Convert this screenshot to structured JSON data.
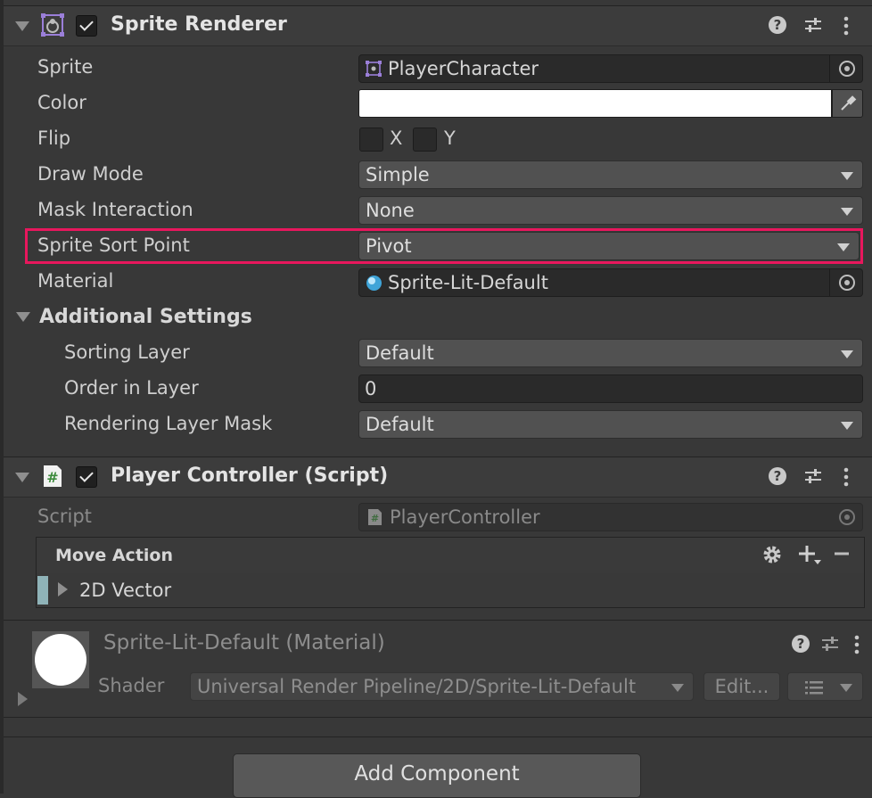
{
  "sprite_renderer": {
    "title": "Sprite Renderer",
    "enabled": true,
    "fields": {
      "sprite": {
        "label": "Sprite",
        "value": "PlayerCharacter"
      },
      "color": {
        "label": "Color",
        "value": "#ffffff"
      },
      "flip": {
        "label": "Flip",
        "x_label": "X",
        "y_label": "Y"
      },
      "draw_mode": {
        "label": "Draw Mode",
        "value": "Simple"
      },
      "mask_interaction": {
        "label": "Mask Interaction",
        "value": "None"
      },
      "sprite_sort_point": {
        "label": "Sprite Sort Point",
        "value": "Pivot"
      },
      "material": {
        "label": "Material",
        "value": "Sprite-Lit-Default"
      }
    },
    "additional_settings": {
      "title": "Additional Settings",
      "sorting_layer": {
        "label": "Sorting Layer",
        "value": "Default"
      },
      "order_in_layer": {
        "label": "Order in Layer",
        "value": "0"
      },
      "rendering_layer_mask": {
        "label": "Rendering Layer Mask",
        "value": "Default"
      }
    }
  },
  "player_controller": {
    "title": "Player Controller (Script)",
    "enabled": true,
    "script": {
      "label": "Script",
      "value": "PlayerController"
    },
    "move_action": {
      "title": "Move Action",
      "binding": "2D Vector"
    }
  },
  "material_section": {
    "title": "Sprite-Lit-Default (Material)",
    "shader_label": "Shader",
    "shader_value": "Universal Render Pipeline/2D/Sprite-Lit-Default",
    "edit_label": "Edit..."
  },
  "add_component_label": "Add Component",
  "colors": {
    "highlight": "#e8175d",
    "background": "#383838",
    "header": "#3c3c3c"
  }
}
